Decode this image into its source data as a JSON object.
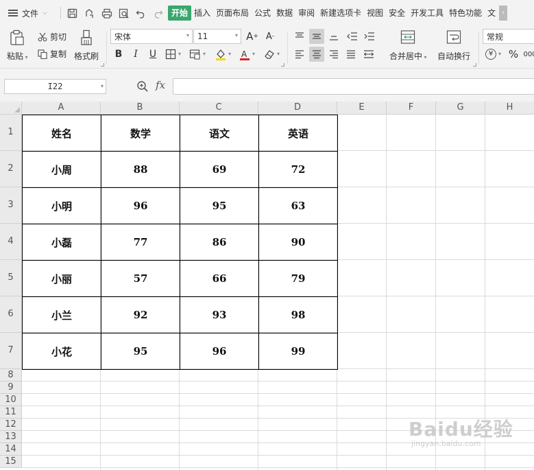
{
  "menubar": {
    "file_label": "文件",
    "tabs": [
      "插入",
      "页面布局",
      "公式",
      "数据",
      "审阅",
      "新建选项卡",
      "视图",
      "安全",
      "开发工具",
      "特色功能",
      "文"
    ],
    "active_tab": "开始"
  },
  "ribbon": {
    "paste": "粘贴",
    "cut": "剪切",
    "copy": "复制",
    "format_painter": "格式刷",
    "font_name": "宋体",
    "font_size": "11",
    "merge_center": "合并居中",
    "wrap_text": "自动换行",
    "number_format": "常规",
    "currency_symbol": "¥",
    "percent_symbol": "%"
  },
  "formula_bar": {
    "name_box": "I22",
    "fx_label": "fx",
    "formula": ""
  },
  "grid": {
    "columns": [
      "A",
      "B",
      "C",
      "D",
      "E",
      "F",
      "G",
      "H"
    ],
    "rows": [
      "1",
      "2",
      "3",
      "4",
      "5",
      "6",
      "7",
      "8",
      "9",
      "10",
      "11",
      "12",
      "13",
      "14",
      "15"
    ],
    "table": [
      [
        "姓名",
        "数学",
        "语文",
        "英语"
      ],
      [
        "小周",
        "88",
        "69",
        "72"
      ],
      [
        "小明",
        "96",
        "95",
        "63"
      ],
      [
        "小磊",
        "77",
        "86",
        "90"
      ],
      [
        "小丽",
        "57",
        "66",
        "79"
      ],
      [
        "小兰",
        "92",
        "93",
        "98"
      ],
      [
        "小花",
        "95",
        "96",
        "99"
      ]
    ]
  },
  "watermark": {
    "logo": "Baidu经验",
    "url": "jingyan.baidu.com"
  },
  "colors": {
    "active_tab": "#3aa76d",
    "font_color_bar": "#e02020",
    "fill_color_bar": "#f5d800"
  }
}
